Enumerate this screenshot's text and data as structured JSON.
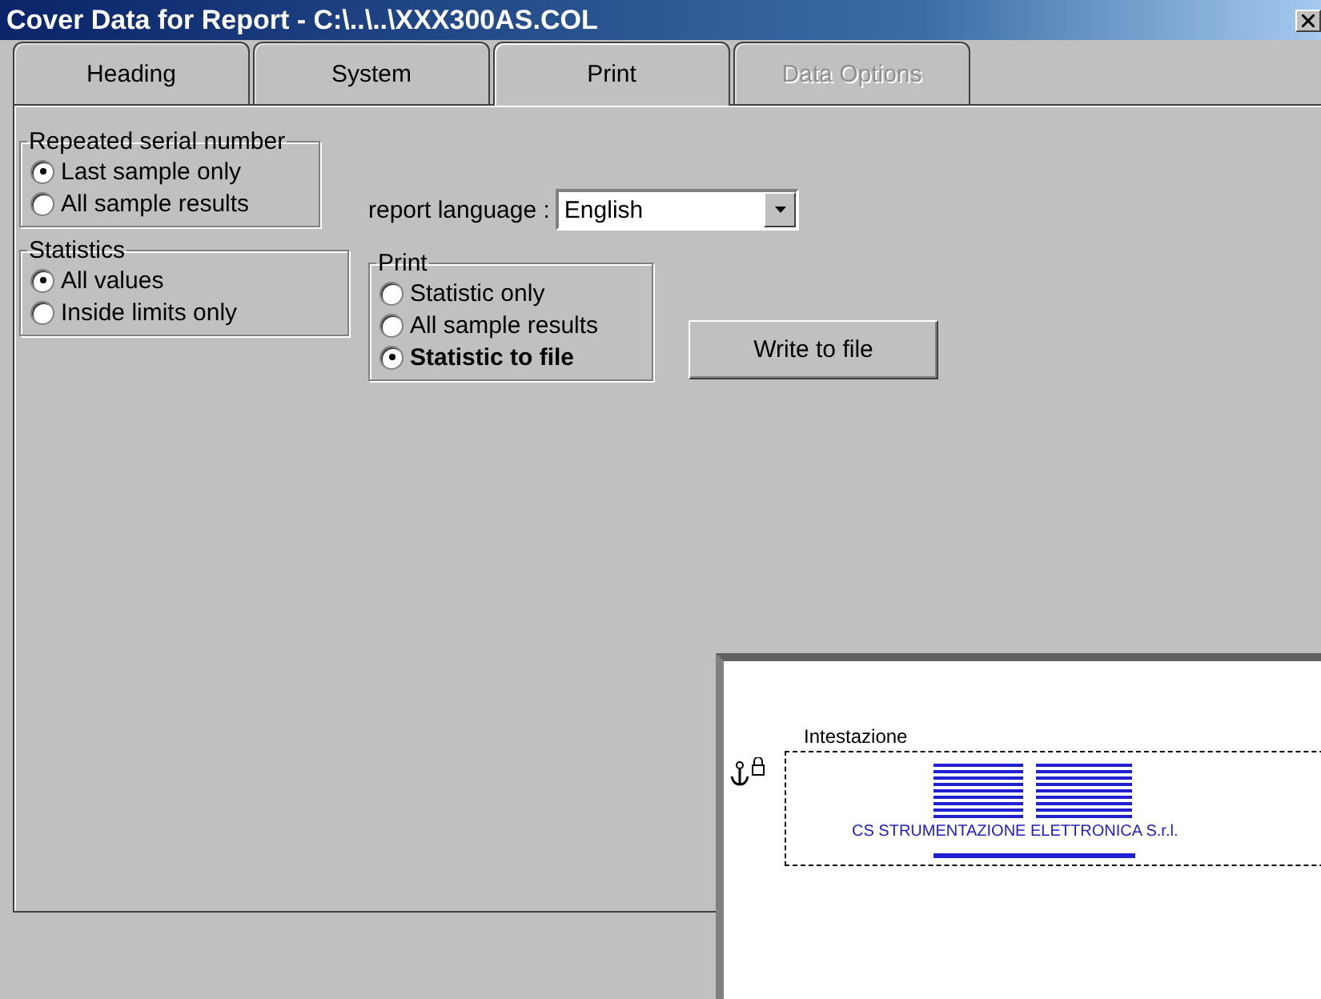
{
  "window": {
    "title": "Cover Data for Report - C:\\..\\..\\XXX300AS.COL"
  },
  "tabs": [
    {
      "label": "Heading",
      "selected": false,
      "disabled": false
    },
    {
      "label": "System",
      "selected": false,
      "disabled": false
    },
    {
      "label": "Print",
      "selected": true,
      "disabled": false
    },
    {
      "label": "Data Options",
      "selected": false,
      "disabled": true
    }
  ],
  "groups": [
    {
      "title": "Repeated serial number",
      "options": [
        {
          "label": "Last sample only",
          "selected": true,
          "bold": false
        },
        {
          "label": "All sample results",
          "selected": false,
          "bold": false
        }
      ]
    },
    {
      "title": "Statistics",
      "options": [
        {
          "label": "All values",
          "selected": true,
          "bold": false
        },
        {
          "label": "Inside limits only",
          "selected": false,
          "bold": false
        }
      ]
    }
  ],
  "language": {
    "label": "report language :",
    "value": "English"
  },
  "print_group": {
    "title": "Print",
    "options": [
      {
        "label": "Statistic only",
        "selected": false,
        "bold": false
      },
      {
        "label": "All sample results",
        "selected": false,
        "bold": false
      },
      {
        "label": "Statistic to file",
        "selected": true,
        "bold": true
      }
    ]
  },
  "write_button": {
    "label": "Write to file"
  },
  "preview": {
    "section_label": "Intestazione",
    "logo_text": "CS STRUMENTAZIONE ELETTRONICA S.r.l."
  }
}
